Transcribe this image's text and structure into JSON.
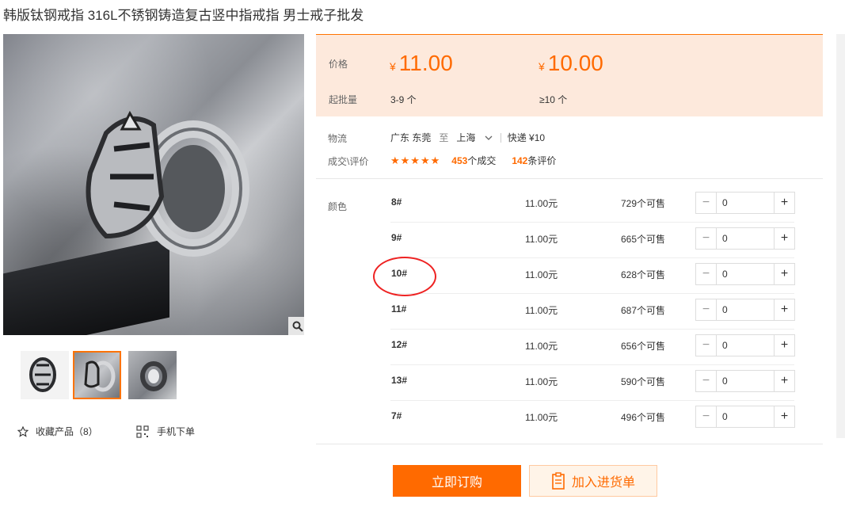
{
  "title": "韩版钛钢戒指 316L不锈钢铸造复古竖中指戒指 男士戒子批发",
  "actions": {
    "favorite": "收藏产品（8）",
    "mobile_order": "手机下单"
  },
  "price": {
    "price_label": "价格",
    "moq_label": "起批量",
    "currency": "¥",
    "tiers": [
      {
        "price": "11.00",
        "qty": "3-9 个"
      },
      {
        "price": "10.00",
        "qty": "≥10 个"
      }
    ]
  },
  "logistics": {
    "label": "物流",
    "from": "广东 东莞",
    "to_word": "至",
    "to": "上海",
    "method": "快递 ¥10"
  },
  "trade": {
    "label": "成交\\评价",
    "stars": "★★★★★",
    "deals_num": "453",
    "deals_text": "个成交",
    "reviews_num": "142",
    "reviews_text": "条评价"
  },
  "sku": {
    "label": "颜色",
    "rows": [
      {
        "name": "8#",
        "price": "11.00元",
        "stock": "729个可售",
        "qty": "0"
      },
      {
        "name": "9#",
        "price": "11.00元",
        "stock": "665个可售",
        "qty": "0"
      },
      {
        "name": "10#",
        "price": "11.00元",
        "stock": "628个可售",
        "qty": "0"
      },
      {
        "name": "11#",
        "price": "11.00元",
        "stock": "687个可售",
        "qty": "0"
      },
      {
        "name": "12#",
        "price": "11.00元",
        "stock": "656个可售",
        "qty": "0"
      },
      {
        "name": "13#",
        "price": "11.00元",
        "stock": "590个可售",
        "qty": "0"
      },
      {
        "name": "7#",
        "price": "11.00元",
        "stock": "496个可售",
        "qty": "0"
      }
    ]
  },
  "buttons": {
    "order": "立即订购",
    "cart": "加入进货单"
  },
  "colors": {
    "accent": "#ff6a00",
    "price_bg": "#fde9dc",
    "highlight": "#e22222"
  }
}
